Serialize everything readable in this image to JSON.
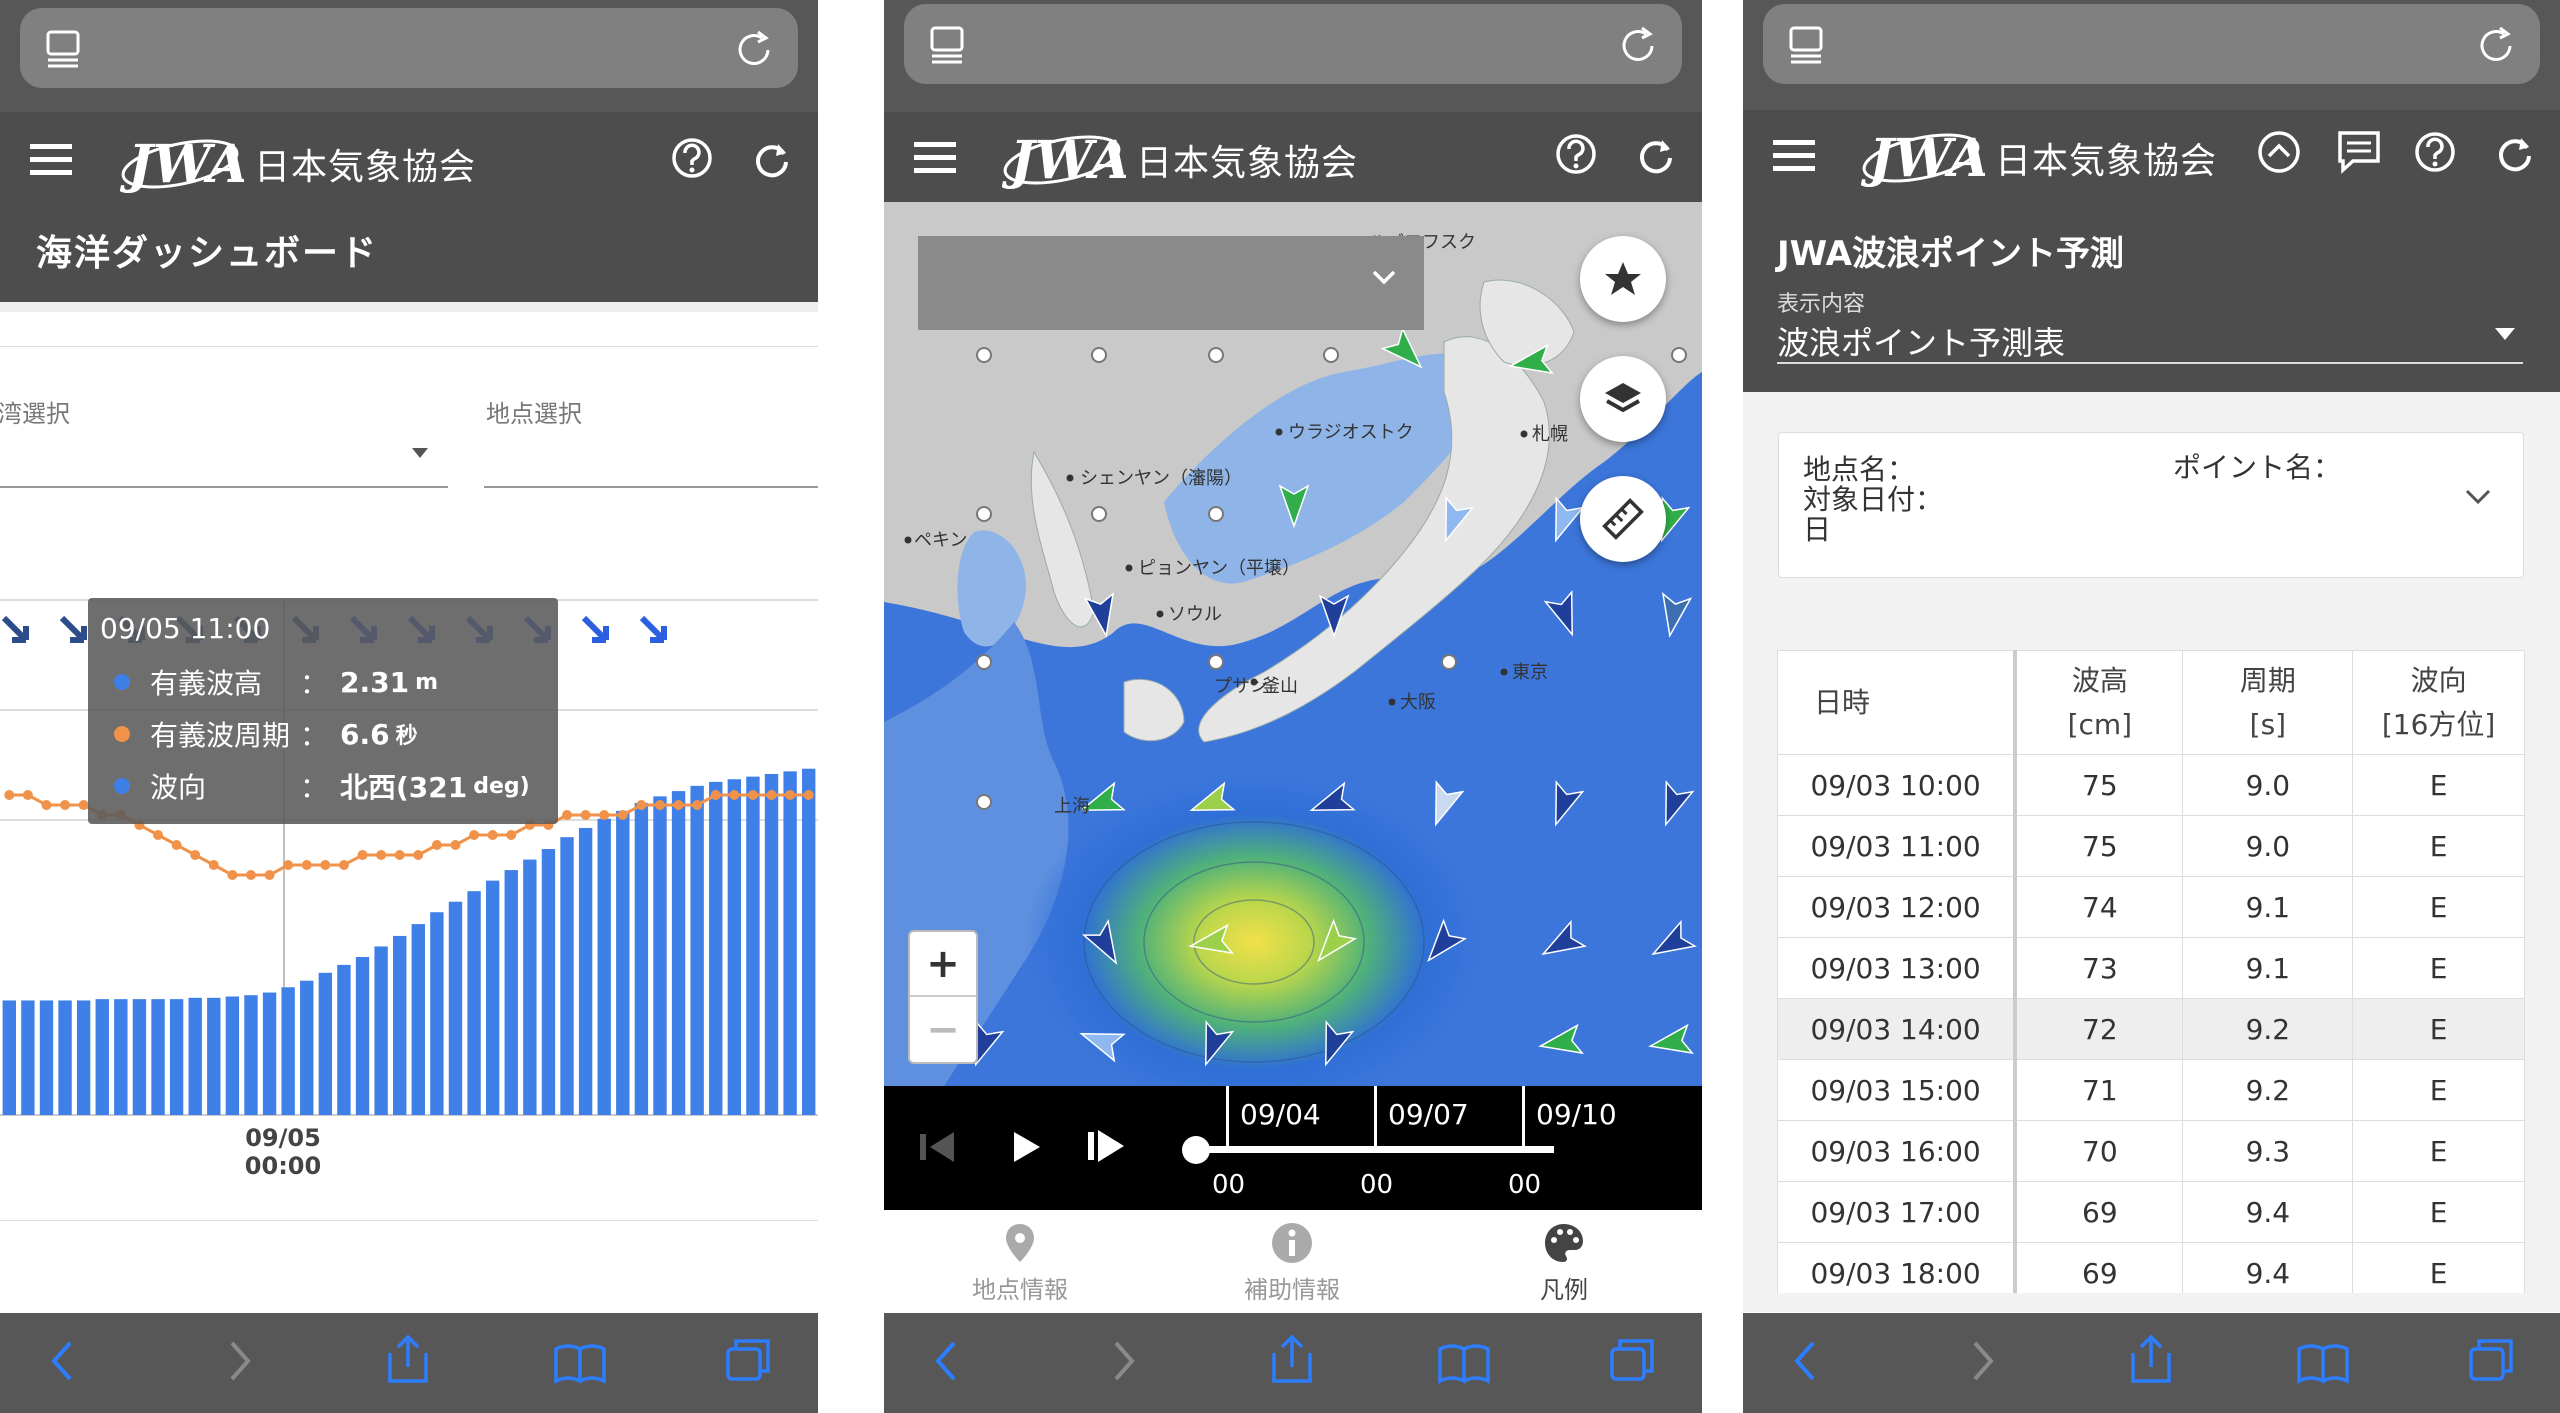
{
  "colors": {
    "header_bg": "#4d4d4d",
    "bar_blue": "#3f7fe8",
    "line_orange": "#f0924a",
    "arrow_blue": "#2b5fe0",
    "arrow_green": "#2fae4a"
  },
  "brand": {
    "name": "日本気象協会"
  },
  "dashboard": {
    "title": "海洋ダッシュボード",
    "bay_select_label": "湾選択",
    "point_select_label": "地点選択",
    "tooltip": {
      "time": "09/05 11:00",
      "rows": [
        {
          "label": "有義波高",
          "colon": "：",
          "value": "2.31",
          "unit": "m"
        },
        {
          "label": "有義波周期",
          "colon": "：",
          "value": "6.6",
          "unit": "秒"
        },
        {
          "label": "波向",
          "colon": "：",
          "value": "北西(321",
          "unit": "deg)"
        }
      ]
    },
    "x_tick": {
      "date": "09/05",
      "time": "00:00"
    }
  },
  "chart_data": {
    "type": "bar",
    "title": "",
    "series": [
      {
        "name": "有義波高",
        "type": "bar",
        "values": [
          0.87,
          0.87,
          0.87,
          0.87,
          0.87,
          0.88,
          0.88,
          0.88,
          0.88,
          0.88,
          0.89,
          0.89,
          0.9,
          0.91,
          0.93,
          0.97,
          1.02,
          1.08,
          1.14,
          1.2,
          1.28,
          1.36,
          1.45,
          1.54,
          1.62,
          1.7,
          1.78,
          1.86,
          1.94,
          2.02,
          2.11,
          2.18,
          2.25,
          2.31,
          2.37,
          2.42,
          2.46,
          2.5,
          2.53,
          2.55,
          2.57,
          2.59,
          2.61,
          2.63
        ]
      },
      {
        "name": "有義波周期",
        "type": "line",
        "values": [
          7.2,
          7.2,
          7.1,
          7.1,
          7.1,
          7.0,
          7.0,
          6.9,
          6.8,
          6.7,
          6.6,
          6.5,
          6.4,
          6.4,
          6.4,
          6.5,
          6.5,
          6.5,
          6.5,
          6.6,
          6.6,
          6.6,
          6.6,
          6.7,
          6.7,
          6.8,
          6.8,
          6.8,
          6.9,
          6.9,
          7.0,
          7.0,
          7.0,
          7.0,
          7.1,
          7.1,
          7.1,
          7.1,
          7.2,
          7.2,
          7.2,
          7.2,
          7.2,
          7.2
        ]
      }
    ],
    "direction_arrows": 12
  },
  "map": {
    "labels": [
      "ハバロフスク",
      "ウラジオストク",
      "シェンヤン（瀋陽）",
      "ペキン",
      "ピョンヤン（平壌）",
      "ソウル",
      "プサン",
      "釜山",
      "大阪",
      "東京",
      "札幌",
      "上海"
    ],
    "timeline": {
      "dates": [
        "09/04",
        "09/07",
        "09/10"
      ],
      "hours": [
        "00",
        "00",
        "00"
      ]
    },
    "tabs": [
      {
        "label": "地点情報",
        "icon": "map-pin-icon"
      },
      {
        "label": "補助情報",
        "icon": "info-icon"
      },
      {
        "label": "凡例",
        "icon": "palette-icon"
      }
    ],
    "zoom_in": "+",
    "zoom_out": "−"
  },
  "forecast": {
    "title": "JWA波浪ポイント予測",
    "display_label": "表示内容",
    "display_value": "波浪ポイント予測表",
    "card": {
      "location_label": "地点名：",
      "point_label": "ポイント名：",
      "date_label": "対象日付：",
      "day_suffix": "日"
    },
    "table": {
      "headers": [
        {
          "l1": "日時",
          "l2": ""
        },
        {
          "l1": "波高",
          "l2": "[cm]"
        },
        {
          "l1": "周期",
          "l2": "[s]"
        },
        {
          "l1": "波向",
          "l2": "[16方位]"
        }
      ],
      "rows": [
        [
          "09/03 10:00",
          "75",
          "9.0",
          "E"
        ],
        [
          "09/03 11:00",
          "75",
          "9.0",
          "E"
        ],
        [
          "09/03 12:00",
          "74",
          "9.1",
          "E"
        ],
        [
          "09/03 13:00",
          "73",
          "9.1",
          "E"
        ],
        [
          "09/03 14:00",
          "72",
          "9.2",
          "E"
        ],
        [
          "09/03 15:00",
          "71",
          "9.2",
          "E"
        ],
        [
          "09/03 16:00",
          "70",
          "9.3",
          "E"
        ],
        [
          "09/03 17:00",
          "69",
          "9.4",
          "E"
        ],
        [
          "09/03 18:00",
          "69",
          "9.4",
          "E"
        ]
      ]
    }
  }
}
